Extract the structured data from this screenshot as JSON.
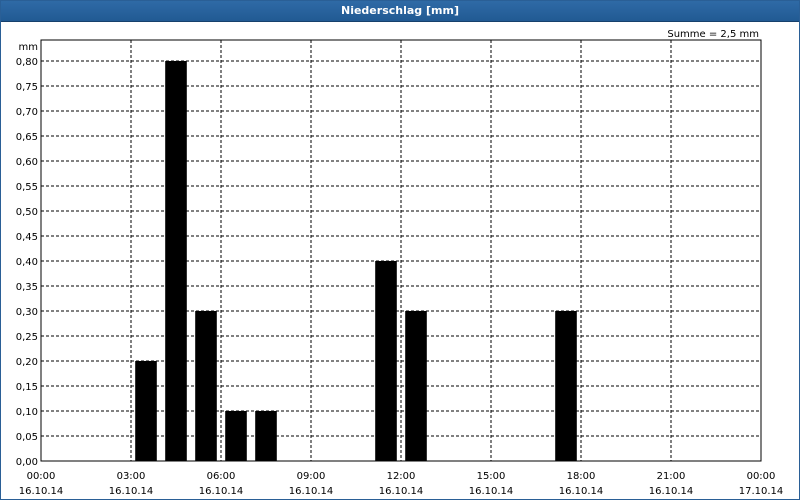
{
  "window": {
    "title": "Niederschlag [mm]"
  },
  "chart_data": {
    "type": "bar",
    "title": "Niederschlag [mm]",
    "ylabel": "mm",
    "xlabel": "",
    "summary": "Summe = 2,5 mm",
    "ylim": [
      0,
      0.8
    ],
    "xlim_hours": [
      0,
      24
    ],
    "y_ticks": [
      "0,00",
      "0,05",
      "0,10",
      "0,15",
      "0,20",
      "0,25",
      "0,30",
      "0,35",
      "0,40",
      "0,45",
      "0,50",
      "0,55",
      "0,60",
      "0,65",
      "0,70",
      "0,75",
      "0,80"
    ],
    "x_ticks": [
      {
        "time": "00:00",
        "date": "16.10.14"
      },
      {
        "time": "03:00",
        "date": "16.10.14"
      },
      {
        "time": "06:00",
        "date": "16.10.14"
      },
      {
        "time": "09:00",
        "date": "16.10.14"
      },
      {
        "time": "12:00",
        "date": "16.10.14"
      },
      {
        "time": "15:00",
        "date": "16.10.14"
      },
      {
        "time": "18:00",
        "date": "16.10.14"
      },
      {
        "time": "21:00",
        "date": "16.10.14"
      },
      {
        "time": "00:00",
        "date": "17.10.14"
      }
    ],
    "series": [
      {
        "bars": [
          {
            "start": "16.10.14 03:00",
            "end": "16.10.14 04:00",
            "value": 0.2
          },
          {
            "start": "16.10.14 04:00",
            "end": "16.10.14 05:00",
            "value": 0.8
          },
          {
            "start": "16.10.14 05:00",
            "end": "16.10.14 06:00",
            "value": 0.3
          },
          {
            "start": "16.10.14 06:00",
            "end": "16.10.14 07:00",
            "value": 0.1
          },
          {
            "start": "16.10.14 07:00",
            "end": "16.10.14 08:00",
            "value": 0.1
          },
          {
            "start": "16.10.14 11:00",
            "end": "16.10.14 12:00",
            "value": 0.4
          },
          {
            "start": "16.10.14 12:00",
            "end": "16.10.14 13:00",
            "value": 0.3
          },
          {
            "start": "16.10.14 17:00",
            "end": "16.10.14 18:00",
            "value": 0.3
          }
        ]
      }
    ],
    "grid": true,
    "bar_color": "#000000",
    "title_bar_color": "#2566a2"
  }
}
